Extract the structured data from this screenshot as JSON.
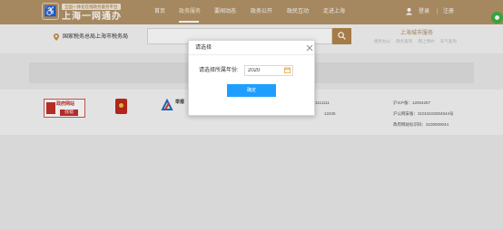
{
  "header": {
    "logo_tag": "全国一体化在线政务服务平台",
    "logo_name": "上海一网通办",
    "nav": [
      {
        "label": "首页"
      },
      {
        "label": "政务服务"
      },
      {
        "label": "要闻动态"
      },
      {
        "label": "政务公开"
      },
      {
        "label": "政民互动"
      },
      {
        "label": "走进上海"
      }
    ],
    "login": "登录",
    "separator": "|",
    "register": "注册"
  },
  "subheader": {
    "location": "国家税务总局上海市税务局",
    "search_placeholder": "",
    "city_title": "上海城市服务",
    "city_links": [
      "便民办公",
      "政务查询",
      "网上预约",
      "天气查询"
    ]
  },
  "footer": {
    "badge_top": "政府网站",
    "badge_bottom": "找错",
    "report_text": "举报",
    "phone": "电话：23111111",
    "service_line": "12345",
    "service_prefix": "上海市政务服务总客服：",
    "icp": "沪ICP备：12004267",
    "police": "沪公网安备：31010102004544号",
    "site_id": "政府网站标识码：3100000044"
  },
  "dialog": {
    "title": "请选择",
    "year_label": "请选择所属年份:",
    "year_value": "2020",
    "confirm_label": "确定"
  },
  "colors": {
    "brand": "#b59469",
    "confirm": "#1e9fff",
    "search_button": "#b4864c"
  },
  "icons": [
    "close-icon",
    "calendar-icon",
    "search-icon",
    "location-pin-icon",
    "user-icon"
  ]
}
